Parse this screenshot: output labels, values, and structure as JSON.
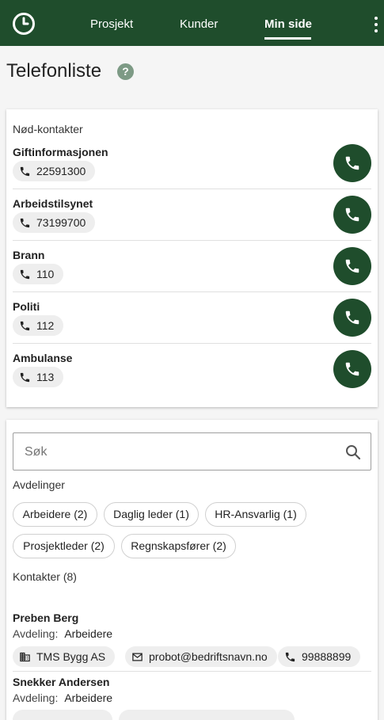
{
  "nav": {
    "items": [
      {
        "label": "Prosjekt"
      },
      {
        "label": "Kunder"
      },
      {
        "label": "Min side"
      }
    ],
    "active": "Min side"
  },
  "page": {
    "title": "Telefonliste",
    "help_glyph": "?"
  },
  "emergency": {
    "label": "Nød-kontakter",
    "contacts": [
      {
        "name": "Giftinformasjonen",
        "phone": "22591300"
      },
      {
        "name": "Arbeidstilsynet",
        "phone": "73199700"
      },
      {
        "name": "Brann",
        "phone": "110"
      },
      {
        "name": "Politi",
        "phone": "112"
      },
      {
        "name": "Ambulanse",
        "phone": "113"
      }
    ]
  },
  "search": {
    "placeholder": "Søk"
  },
  "departments": {
    "label": "Avdelinger",
    "chips": [
      {
        "label": "Arbeidere (2)"
      },
      {
        "label": "Daglig leder (1)"
      },
      {
        "label": "HR-Ansvarlig (1)"
      },
      {
        "label": "Prosjektleder (2)"
      },
      {
        "label": "Regnskapsfører (2)"
      }
    ]
  },
  "contacts": {
    "label": "Kontakter (8)",
    "dept_prefix": "Avdeling:",
    "items": [
      {
        "name": "Preben Berg",
        "department": "Arbeidere",
        "company": "TMS Bygg AS",
        "email": "probot@bedriftsnavn.no",
        "phone": "99888899"
      },
      {
        "name": "Snekker Andersen",
        "department": "Arbeidere"
      }
    ]
  },
  "colors": {
    "brand": "#1f4d2c",
    "help": "#7d9a85",
    "chip_bg": "#eeeeee"
  }
}
